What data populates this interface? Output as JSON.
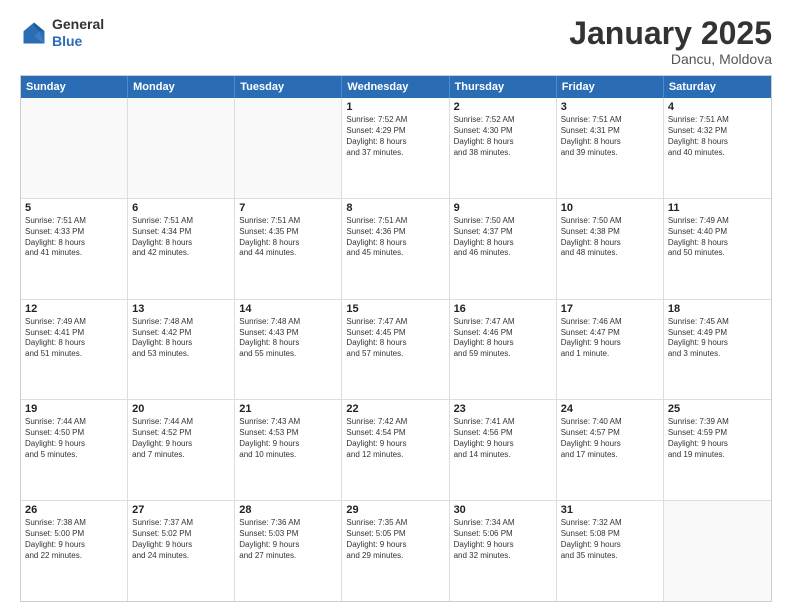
{
  "header": {
    "logo_general": "General",
    "logo_blue": "Blue",
    "month_title": "January 2025",
    "location": "Dancu, Moldova"
  },
  "weekdays": [
    "Sunday",
    "Monday",
    "Tuesday",
    "Wednesday",
    "Thursday",
    "Friday",
    "Saturday"
  ],
  "rows": [
    [
      {
        "day": "",
        "text": "",
        "empty": true
      },
      {
        "day": "",
        "text": "",
        "empty": true
      },
      {
        "day": "",
        "text": "",
        "empty": true
      },
      {
        "day": "1",
        "text": "Sunrise: 7:52 AM\nSunset: 4:29 PM\nDaylight: 8 hours\nand 37 minutes.",
        "empty": false
      },
      {
        "day": "2",
        "text": "Sunrise: 7:52 AM\nSunset: 4:30 PM\nDaylight: 8 hours\nand 38 minutes.",
        "empty": false
      },
      {
        "day": "3",
        "text": "Sunrise: 7:51 AM\nSunset: 4:31 PM\nDaylight: 8 hours\nand 39 minutes.",
        "empty": false
      },
      {
        "day": "4",
        "text": "Sunrise: 7:51 AM\nSunset: 4:32 PM\nDaylight: 8 hours\nand 40 minutes.",
        "empty": false
      }
    ],
    [
      {
        "day": "5",
        "text": "Sunrise: 7:51 AM\nSunset: 4:33 PM\nDaylight: 8 hours\nand 41 minutes.",
        "empty": false
      },
      {
        "day": "6",
        "text": "Sunrise: 7:51 AM\nSunset: 4:34 PM\nDaylight: 8 hours\nand 42 minutes.",
        "empty": false
      },
      {
        "day": "7",
        "text": "Sunrise: 7:51 AM\nSunset: 4:35 PM\nDaylight: 8 hours\nand 44 minutes.",
        "empty": false
      },
      {
        "day": "8",
        "text": "Sunrise: 7:51 AM\nSunset: 4:36 PM\nDaylight: 8 hours\nand 45 minutes.",
        "empty": false
      },
      {
        "day": "9",
        "text": "Sunrise: 7:50 AM\nSunset: 4:37 PM\nDaylight: 8 hours\nand 46 minutes.",
        "empty": false
      },
      {
        "day": "10",
        "text": "Sunrise: 7:50 AM\nSunset: 4:38 PM\nDaylight: 8 hours\nand 48 minutes.",
        "empty": false
      },
      {
        "day": "11",
        "text": "Sunrise: 7:49 AM\nSunset: 4:40 PM\nDaylight: 8 hours\nand 50 minutes.",
        "empty": false
      }
    ],
    [
      {
        "day": "12",
        "text": "Sunrise: 7:49 AM\nSunset: 4:41 PM\nDaylight: 8 hours\nand 51 minutes.",
        "empty": false
      },
      {
        "day": "13",
        "text": "Sunrise: 7:48 AM\nSunset: 4:42 PM\nDaylight: 8 hours\nand 53 minutes.",
        "empty": false
      },
      {
        "day": "14",
        "text": "Sunrise: 7:48 AM\nSunset: 4:43 PM\nDaylight: 8 hours\nand 55 minutes.",
        "empty": false
      },
      {
        "day": "15",
        "text": "Sunrise: 7:47 AM\nSunset: 4:45 PM\nDaylight: 8 hours\nand 57 minutes.",
        "empty": false
      },
      {
        "day": "16",
        "text": "Sunrise: 7:47 AM\nSunset: 4:46 PM\nDaylight: 8 hours\nand 59 minutes.",
        "empty": false
      },
      {
        "day": "17",
        "text": "Sunrise: 7:46 AM\nSunset: 4:47 PM\nDaylight: 9 hours\nand 1 minute.",
        "empty": false
      },
      {
        "day": "18",
        "text": "Sunrise: 7:45 AM\nSunset: 4:49 PM\nDaylight: 9 hours\nand 3 minutes.",
        "empty": false
      }
    ],
    [
      {
        "day": "19",
        "text": "Sunrise: 7:44 AM\nSunset: 4:50 PM\nDaylight: 9 hours\nand 5 minutes.",
        "empty": false
      },
      {
        "day": "20",
        "text": "Sunrise: 7:44 AM\nSunset: 4:52 PM\nDaylight: 9 hours\nand 7 minutes.",
        "empty": false
      },
      {
        "day": "21",
        "text": "Sunrise: 7:43 AM\nSunset: 4:53 PM\nDaylight: 9 hours\nand 10 minutes.",
        "empty": false
      },
      {
        "day": "22",
        "text": "Sunrise: 7:42 AM\nSunset: 4:54 PM\nDaylight: 9 hours\nand 12 minutes.",
        "empty": false
      },
      {
        "day": "23",
        "text": "Sunrise: 7:41 AM\nSunset: 4:56 PM\nDaylight: 9 hours\nand 14 minutes.",
        "empty": false
      },
      {
        "day": "24",
        "text": "Sunrise: 7:40 AM\nSunset: 4:57 PM\nDaylight: 9 hours\nand 17 minutes.",
        "empty": false
      },
      {
        "day": "25",
        "text": "Sunrise: 7:39 AM\nSunset: 4:59 PM\nDaylight: 9 hours\nand 19 minutes.",
        "empty": false
      }
    ],
    [
      {
        "day": "26",
        "text": "Sunrise: 7:38 AM\nSunset: 5:00 PM\nDaylight: 9 hours\nand 22 minutes.",
        "empty": false
      },
      {
        "day": "27",
        "text": "Sunrise: 7:37 AM\nSunset: 5:02 PM\nDaylight: 9 hours\nand 24 minutes.",
        "empty": false
      },
      {
        "day": "28",
        "text": "Sunrise: 7:36 AM\nSunset: 5:03 PM\nDaylight: 9 hours\nand 27 minutes.",
        "empty": false
      },
      {
        "day": "29",
        "text": "Sunrise: 7:35 AM\nSunset: 5:05 PM\nDaylight: 9 hours\nand 29 minutes.",
        "empty": false
      },
      {
        "day": "30",
        "text": "Sunrise: 7:34 AM\nSunset: 5:06 PM\nDaylight: 9 hours\nand 32 minutes.",
        "empty": false
      },
      {
        "day": "31",
        "text": "Sunrise: 7:32 AM\nSunset: 5:08 PM\nDaylight: 9 hours\nand 35 minutes.",
        "empty": false
      },
      {
        "day": "",
        "text": "",
        "empty": true
      }
    ]
  ]
}
